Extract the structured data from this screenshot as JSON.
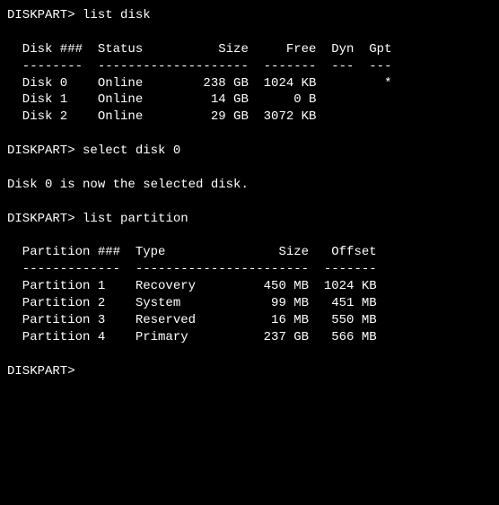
{
  "prompt": "DISKPART>",
  "commands": {
    "list_disk": "list disk",
    "select_disk": "select disk 0",
    "list_partition": "list partition"
  },
  "disk_header": {
    "col1": "Disk ###",
    "col2": "Status",
    "col3": "Size",
    "col4": "Free",
    "col5": "Dyn",
    "col6": "Gpt"
  },
  "disk_divider": {
    "col1": "--------",
    "col2": "-------------",
    "col3": "-------",
    "col4": "-------",
    "col5": "---",
    "col6": "---"
  },
  "disks": [
    {
      "name": "Disk 0",
      "status": "Online",
      "size": "238 GB",
      "free": "1024 KB",
      "dyn": "",
      "gpt": "*"
    },
    {
      "name": "Disk 1",
      "status": "Online",
      "size": "14 GB",
      "free": "0 B",
      "dyn": "",
      "gpt": ""
    },
    {
      "name": "Disk 2",
      "status": "Online",
      "size": "29 GB",
      "free": "3072 KB",
      "dyn": "",
      "gpt": ""
    }
  ],
  "select_response": "Disk 0 is now the selected disk.",
  "partition_header": {
    "col1": "Partition ###",
    "col2": "Type",
    "col3": "Size",
    "col4": "Offset"
  },
  "partition_divider": {
    "col1": "-------------",
    "col2": "----------------",
    "col3": "-------",
    "col4": "-------"
  },
  "partitions": [
    {
      "name": "Partition 1",
      "type": "Recovery",
      "size": "450 MB",
      "offset": "1024 KB"
    },
    {
      "name": "Partition 2",
      "type": "System",
      "size": "99 MB",
      "offset": "451 MB"
    },
    {
      "name": "Partition 3",
      "type": "Reserved",
      "size": "16 MB",
      "offset": "550 MB"
    },
    {
      "name": "Partition 4",
      "type": "Primary",
      "size": "237 GB",
      "offset": "566 MB"
    }
  ]
}
